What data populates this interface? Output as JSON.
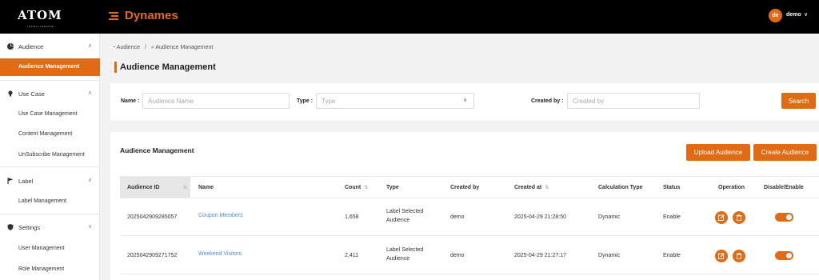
{
  "header": {
    "logo_text": "ATOM",
    "logo_sub": "INTELLIGENCE",
    "app_title": "Dynames",
    "user_avatar": "de",
    "user_name": "demo"
  },
  "sidebar": {
    "groups": [
      {
        "label": "Audience",
        "icon": "pie-chart-icon",
        "items": [
          "Audience Management"
        ]
      },
      {
        "label": "Use Case",
        "icon": "bulb-icon",
        "items": [
          "Use Case Management",
          "Content Management",
          "UnSubscribe Management"
        ]
      },
      {
        "label": "Label",
        "icon": "flag-icon",
        "items": [
          "Label Management"
        ]
      },
      {
        "label": "Settings",
        "icon": "shield-icon",
        "items": [
          "User Management",
          "Role Management"
        ]
      }
    ],
    "active_item": "Audience Management"
  },
  "breadcrumb": {
    "root": "Audience",
    "separator": "/",
    "current": "Audience Management"
  },
  "page_title": "Audience Management",
  "filters": {
    "name_label": "Name :",
    "name_placeholder": "Audience Name",
    "type_label": "Type :",
    "type_placeholder": "Type",
    "created_by_label": "Created by :",
    "created_by_placeholder": "Created by",
    "search_button": "Search"
  },
  "table_card": {
    "title": "Audience Management",
    "upload_button": "Upload Audience",
    "create_button": "Create Audience",
    "columns": [
      "Audience ID",
      "Name",
      "Count",
      "Type",
      "Created by",
      "Created at",
      "Calculation Type",
      "Status",
      "Operation",
      "Disable/Enable"
    ],
    "rows": [
      {
        "id": "2025042909285057",
        "name": "Coupon Members",
        "count": "1,658",
        "type_line1": "Label Selected",
        "type_line2": "Audience",
        "created_by": "demo",
        "created_at": "2025-04-29 21:28:50",
        "calc_type": "Dynamic",
        "status": "Enable",
        "enabled": true
      },
      {
        "id": "2025042909271752",
        "name": "Weekend Visitors",
        "count": "2,411",
        "type_line1": "Label Selected",
        "type_line2": "Audience",
        "created_by": "demo",
        "created_at": "2025-04-29 21:27:17",
        "calc_type": "Dynamic",
        "status": "Enable",
        "enabled": true
      }
    ]
  },
  "colors": {
    "accent": "#e06b14",
    "link": "#4a8fd1",
    "topbar": "#000000"
  }
}
